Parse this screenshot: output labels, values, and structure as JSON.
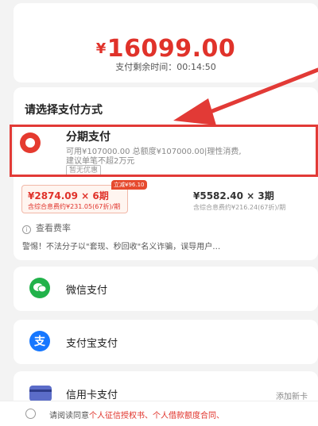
{
  "amount": {
    "currency": "¥",
    "value": "16099.00"
  },
  "timer": "支付剩余时间：00:14:50",
  "section_title": "请选择支付方式",
  "installment": {
    "title": "分期支付",
    "desc1": "可用¥107000.00 总额度¥107000.00|理性消费,",
    "desc2": "建议单笔不超2万元",
    "tag": "暂无优惠",
    "icon": "installment-logo-icon"
  },
  "plans": [
    {
      "main": "¥2874.09 × 6期",
      "sub": "含综合息费约¥231.05(67折)/期",
      "badge": "立减¥96.10",
      "selected": true
    },
    {
      "main": "¥5582.40 × 3期",
      "sub": "含综合息费约¥216.24(67折)/期",
      "selected": false
    }
  ],
  "rate_link": "查看费率",
  "warning": "警惕！不法分子以\"套现、秒回收\"名义诈骗，误导用户…",
  "methods": {
    "wechat": {
      "label": "微信支付",
      "icon": "wechat-icon"
    },
    "alipay": {
      "label": "支付宝支付",
      "icon": "alipay-icon",
      "glyph": "支"
    },
    "card": {
      "label": "信用卡支付",
      "icon": "credit-card-icon",
      "action": "添加新卡"
    }
  },
  "agreement": {
    "prefix": "请阅读同意",
    "links": "个人征信授权书、个人借款额度合同、"
  },
  "colors": {
    "accent": "#e0322a",
    "highlight_frame": "#e23a36",
    "wechat": "#21b24a",
    "alipay": "#1677ff"
  }
}
